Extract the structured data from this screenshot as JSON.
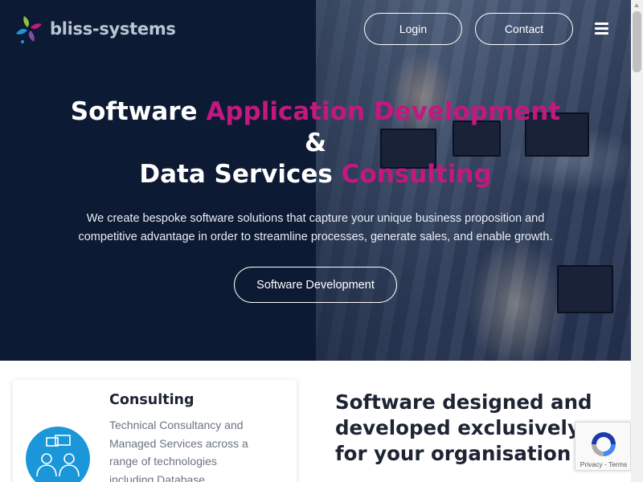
{
  "brand": {
    "name": "bliss-systems"
  },
  "nav": {
    "login": "Login",
    "contact": "Contact",
    "menu_icon": "hamburger-menu-icon"
  },
  "hero": {
    "title_line1_plain": "Software",
    "title_line1_accent": "Application Development",
    "title_line2": "&",
    "title_line3_plain": "Data Services",
    "title_line3_accent": "Consulting",
    "description": "We create bespoke software solutions that capture your unique business proposition and competitive advantage in order to streamline processes, generate sales, and enable growth.",
    "cta": "Software Development"
  },
  "service_card": {
    "title": "Consulting",
    "text": "Technical Consultancy and Managed Services across a range of technologies including Database",
    "icon": "consulting-people-icon"
  },
  "section": {
    "title": "Software designed and developed exclusively for your organisation"
  },
  "recaptcha": {
    "privacy": "Privacy",
    "separator": " - ",
    "terms": "Terms"
  },
  "colors": {
    "hero_bg": "#0d1a33",
    "accent": "#c2187f",
    "icon_blue": "#1b97d9",
    "heading": "#1e2434"
  }
}
